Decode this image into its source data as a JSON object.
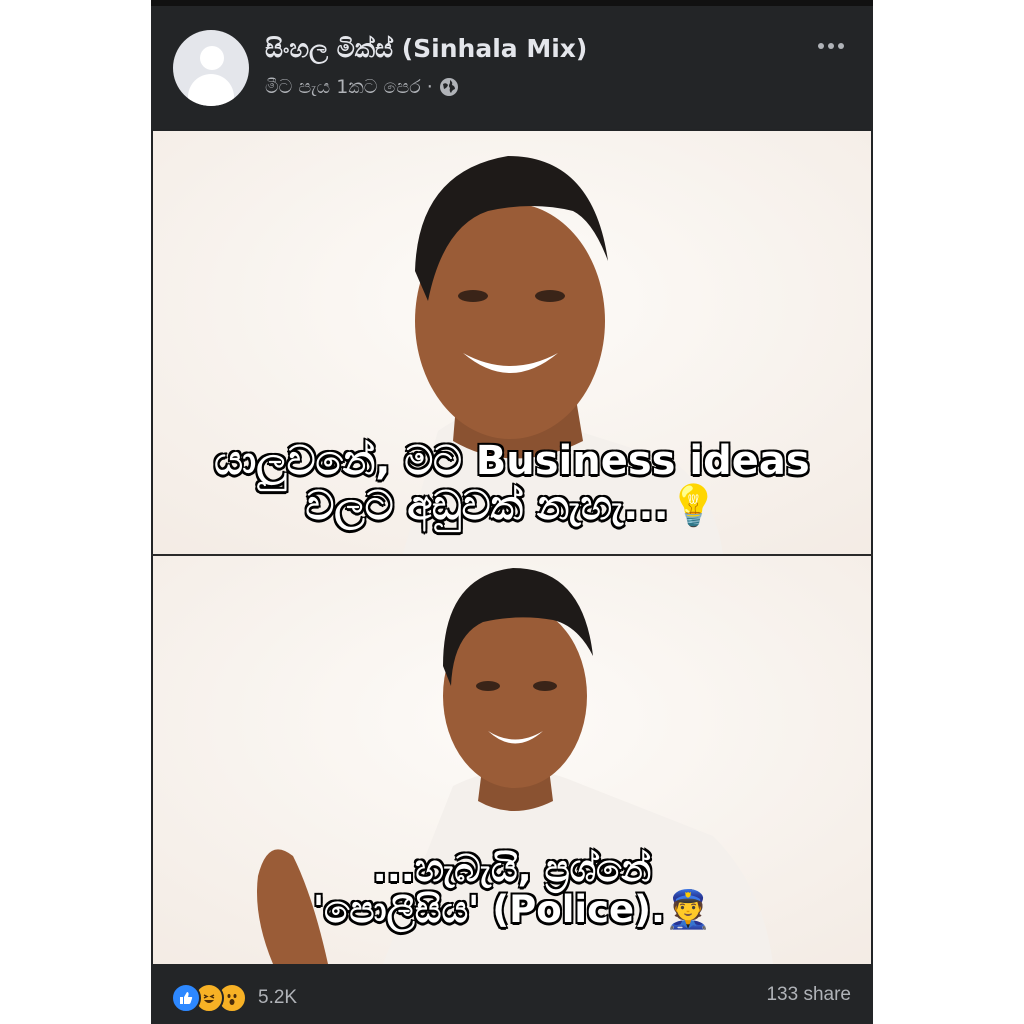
{
  "post": {
    "page_name": "සිංහල මික්ස් (Sinhala Mix)",
    "time_label": "මීට පැය 1කට පෙර ·",
    "privacy_icon": "globe-icon",
    "more_icon": "more-options-icon"
  },
  "meme": {
    "panel_1": {
      "caption_line_1": "යාලුවනේ, මට Business ideas",
      "caption_line_2": "වලට අඩුවක් නැහැ...",
      "emoji": "💡"
    },
    "panel_2": {
      "caption_line_1": "...හැබැයි, ප්‍රශ්නේ",
      "caption_line_2": "'පොලීසිය' (Police).",
      "emoji": "👮"
    }
  },
  "footer": {
    "reactions": [
      "like-icon",
      "haha-icon",
      "wow-icon"
    ],
    "reaction_count": "5.2K",
    "share_count": "133 share"
  },
  "colors": {
    "background": "#232527",
    "text_primary": "#e4e6eb",
    "text_secondary": "#b0b3b8",
    "like_blue": "#2d88ff"
  }
}
